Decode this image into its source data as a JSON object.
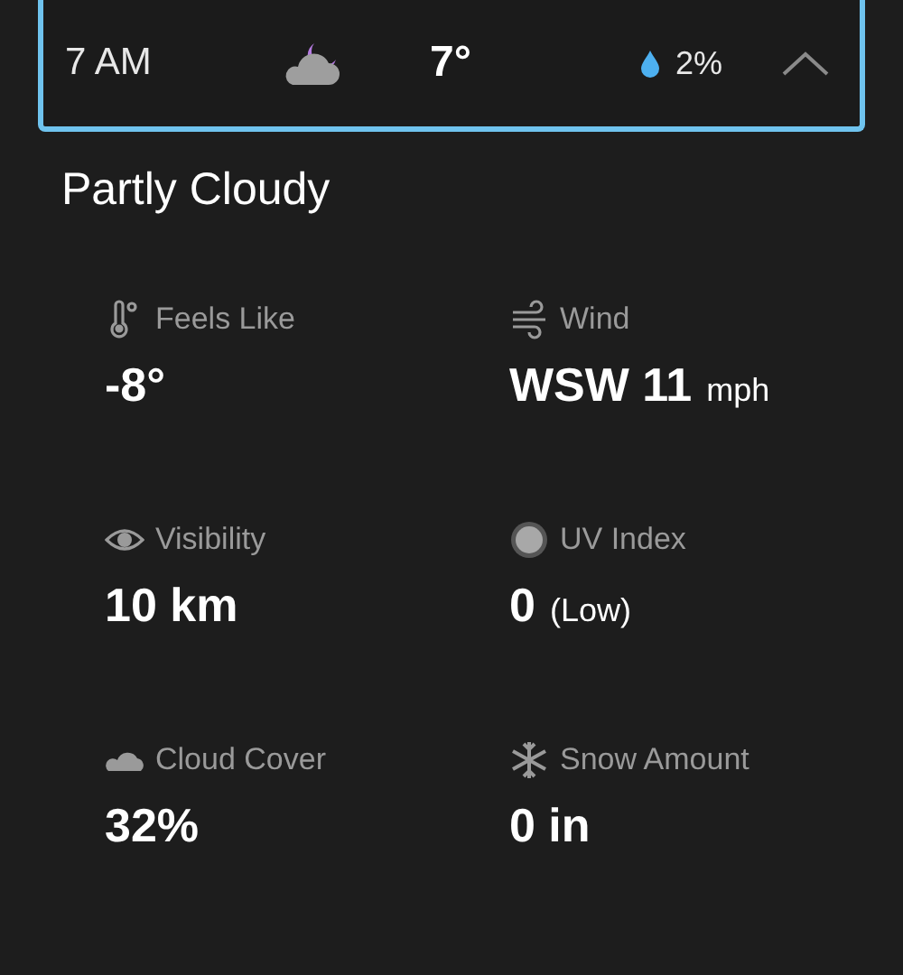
{
  "hour_row": {
    "time": "7 AM",
    "temperature": "7°",
    "precipitation": "2%",
    "expanded": true,
    "selected": true
  },
  "condition": "Partly Cloudy",
  "details": [
    {
      "kind": "thermometer",
      "label": "Feels Like",
      "value": "-8°"
    },
    {
      "kind": "wind",
      "label": "Wind",
      "value": "WSW 11",
      "unit": "mph"
    },
    {
      "kind": "visibility",
      "label": "Visibility",
      "value": "10 km"
    },
    {
      "kind": "uv",
      "label": "UV Index",
      "value": "0",
      "unit": "(Low)"
    },
    {
      "kind": "cloud",
      "label": "Cloud Cover",
      "value": "32%"
    },
    {
      "kind": "snow",
      "label": "Snow Amount",
      "value": "0 in"
    }
  ]
}
